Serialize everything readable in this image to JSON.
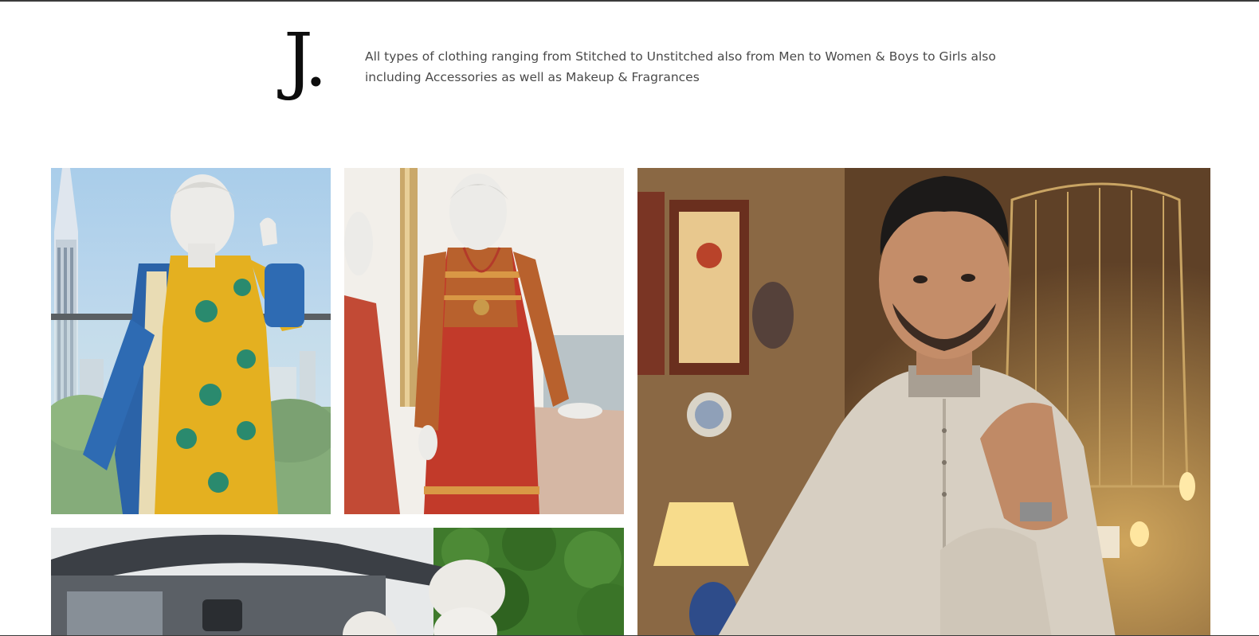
{
  "brand": {
    "logo_text": "J.",
    "description": "All types of clothing ranging from Stitched to Unstitched also from Men to Women & Boys to Girls also including Accessories as well as Makeup & Fragrances"
  },
  "gallery": {
    "tiles": [
      {
        "subject": "mannequin-yellow-printed-suit"
      },
      {
        "subject": "mannequin-red-embroidered-kurta"
      },
      {
        "subject": "man-in-beige-kurta"
      },
      {
        "subject": "mannequins-with-vintage-car"
      }
    ]
  },
  "colors": {
    "text": "#4a4a4a",
    "logo": "#0d0d0d",
    "border": "#3a3a3a",
    "background": "#ffffff"
  }
}
